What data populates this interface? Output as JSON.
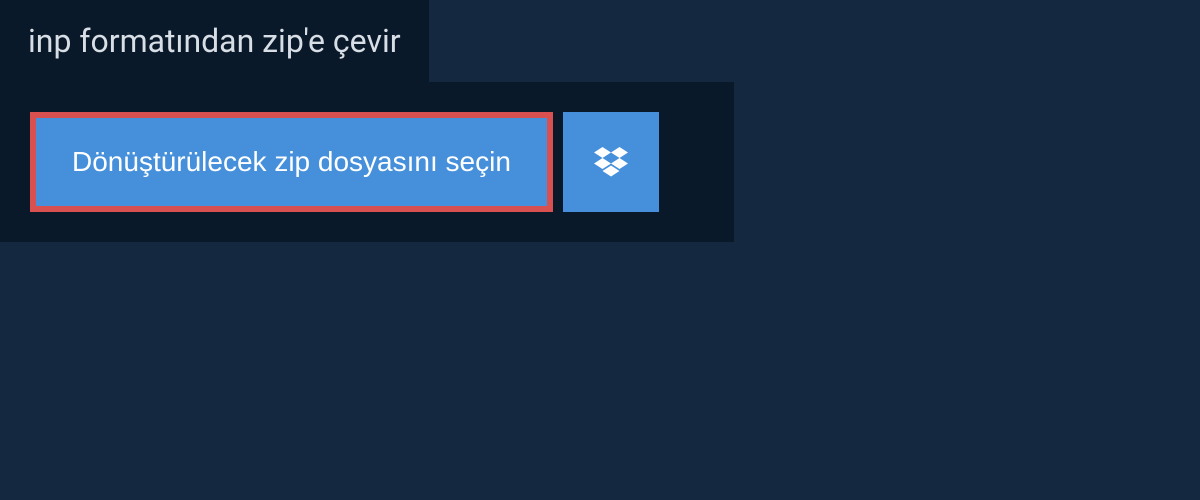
{
  "header": {
    "title": "inp formatından zip'e çevir"
  },
  "actions": {
    "file_select_label": "Dönüştürülecek zip dosyasını seçin"
  },
  "colors": {
    "background": "#14283f",
    "panel": "#0a1929",
    "button": "#4690db",
    "highlight_border": "#d95050"
  }
}
